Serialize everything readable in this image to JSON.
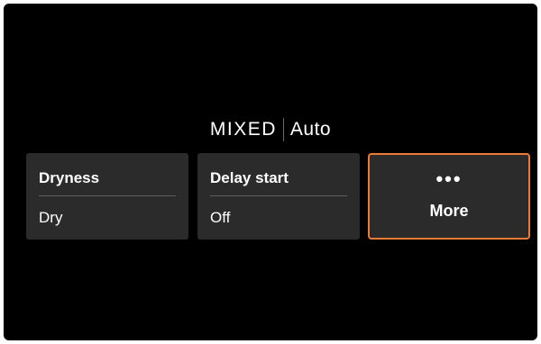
{
  "header": {
    "program": "MIXED",
    "mode": "Auto"
  },
  "tiles": [
    {
      "label": "Dryness",
      "value": "Dry"
    },
    {
      "label": "Delay start",
      "value": "Off"
    }
  ],
  "more": {
    "dots": "•••",
    "label": "More"
  },
  "colors": {
    "background": "#000000",
    "tile": "#2b2b2b",
    "accent": "#ef7a34",
    "text": "#ffffff"
  },
  "icons": {
    "more": "ellipsis-icon"
  }
}
